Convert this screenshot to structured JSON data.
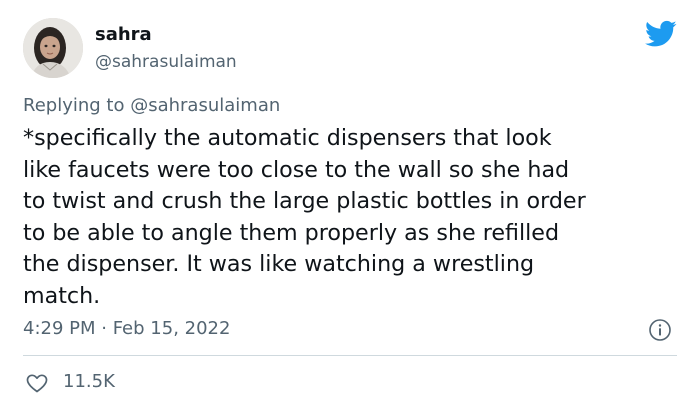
{
  "author": {
    "display_name": "sahra",
    "handle": "@sahrasulaiman"
  },
  "reply": {
    "prefix": "Replying to",
    "handle": "@sahrasulaiman"
  },
  "tweet": {
    "lines": [
      "*specifically the automatic dispensers that look",
      "like faucets were too close to the wall so she had",
      "to twist and crush the large plastic bottles in order",
      "to be able to angle them properly as she refilled",
      "the dispenser. It was like watching a wrestling",
      "match."
    ]
  },
  "meta": {
    "timestamp": "4:29 PM · Feb 15, 2022"
  },
  "engagement": {
    "likes": "11.5K"
  },
  "icons": {
    "brand": "twitter-bird-icon",
    "info": "info-icon",
    "like": "heart-icon"
  },
  "colors": {
    "brand": "#1d9bf0",
    "text_primary": "#0f1419",
    "text_secondary": "#536471",
    "divider": "#cfd9de"
  }
}
